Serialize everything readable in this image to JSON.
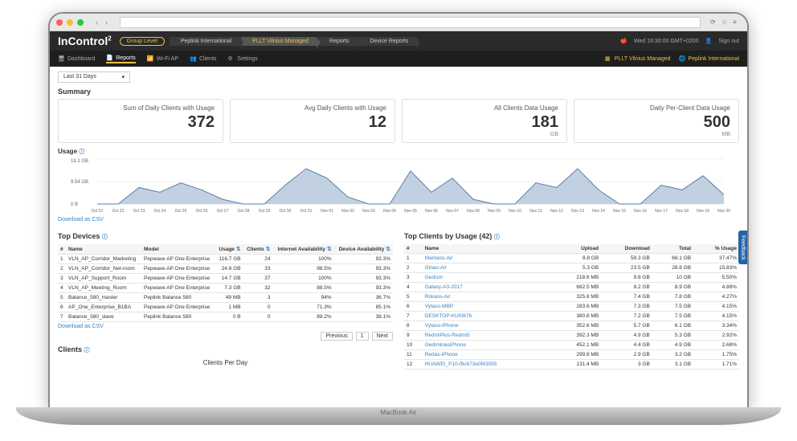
{
  "browser": {
    "macbook_label": "MacBook Air"
  },
  "topbar": {
    "logo": "InControl",
    "logo_sup": "2",
    "group_level": "Group Level",
    "crumbs": [
      "Peplink International",
      "PLLT Vilnius Managed",
      "Reports",
      "Device Reports"
    ],
    "active_crumb": 1,
    "time": "Wed 16:30:00 GMT+0200",
    "user_icon": "user",
    "signout": "Sign out"
  },
  "nav": {
    "items": [
      {
        "icon": "monitor",
        "label": "Dashboard"
      },
      {
        "icon": "doc",
        "label": "Reports"
      },
      {
        "icon": "wifi",
        "label": "Wi-Fi AP"
      },
      {
        "icon": "users",
        "label": "Clients"
      },
      {
        "icon": "gear",
        "label": "Settings"
      }
    ],
    "active": 1,
    "right": [
      {
        "icon": "grid",
        "label": "PLLT Vilnius Managed"
      },
      {
        "icon": "globe",
        "label": "Peplink International"
      }
    ]
  },
  "period": {
    "label": "Last 31 Days"
  },
  "summary": {
    "title": "Summary",
    "cards": [
      {
        "label": "Sum of Daily Clients with Usage",
        "value": "372",
        "unit": ""
      },
      {
        "label": "Avg Daily Clients with Usage",
        "value": "12",
        "unit": ""
      },
      {
        "label": "All Clients Data Usage",
        "value": "181",
        "unit": "GB"
      },
      {
        "label": "Daily Per-Client Data Usage",
        "value": "500",
        "unit": "MB"
      }
    ]
  },
  "usage": {
    "title": "Usage",
    "ymax_label": "19.1 GB",
    "ymid_label": "9.54 GB",
    "ymin_label": "0 B",
    "csv": "Download as CSV"
  },
  "chart_data": {
    "type": "area",
    "title": "Usage",
    "ylabel": "Data",
    "ylim": [
      0,
      19.1
    ],
    "y_unit": "GB",
    "categories": [
      "Oct 21",
      "Oct 22",
      "Oct 23",
      "Oct 24",
      "Oct 25",
      "Oct 26",
      "Oct 27",
      "Oct 28",
      "Oct 29",
      "Oct 30",
      "Oct 31",
      "Nov 01",
      "Nov 02",
      "Nov 03",
      "Nov 04",
      "Nov 05",
      "Nov 06",
      "Nov 07",
      "Nov 08",
      "Nov 09",
      "Nov 10",
      "Nov 11",
      "Nov 12",
      "Nov 13",
      "Nov 14",
      "Nov 15",
      "Nov 16",
      "Nov 17",
      "Nov 18",
      "Nov 19",
      "Nov 20"
    ],
    "values": [
      0,
      0,
      7,
      5,
      9,
      6,
      2,
      0,
      0,
      8,
      15,
      11,
      3,
      0,
      0,
      14,
      5,
      11,
      2,
      0,
      0,
      9,
      7,
      15,
      6,
      0,
      0,
      8,
      6,
      12,
      4
    ]
  },
  "top_devices": {
    "title": "Top Devices",
    "headers": [
      "#",
      "Name",
      "Model",
      "Usage",
      "Clients",
      "Internet Availability",
      "Device Availability"
    ],
    "rows": [
      [
        "1",
        "VLN_AP_Corridor_Marketing",
        "Pepwave AP One Enterprise",
        "116.7 GB",
        "24",
        "100%",
        "93.3%"
      ],
      [
        "2",
        "VLN_AP_Corridor_Net-room",
        "Pepwave AP One Enterprise",
        "24.8 GB",
        "33",
        "98.5%",
        "93.3%"
      ],
      [
        "3",
        "VLN_AP_Support_Room",
        "Pepwave AP One Enterprise",
        "14.7 GB",
        "37",
        "100%",
        "93.3%"
      ],
      [
        "4",
        "VLN_AP_Meeting_Room",
        "Pepwave AP One Enterprise",
        "7.3 GB",
        "32",
        "88.5%",
        "93.3%"
      ],
      [
        "5",
        "Balance_580_master",
        "Peplink Balance 580",
        "49 MB",
        "3",
        "94%",
        "36.7%"
      ],
      [
        "6",
        "AP_One_Enterprise_B1BA",
        "Pepwave AP One Enterprise",
        "1 MB",
        "0",
        "71.3%",
        "85.1%"
      ],
      [
        "7",
        "Balance_580_slave",
        "Peplink Balance 580",
        "0 B",
        "0",
        "89.2%",
        "38.1%"
      ]
    ],
    "csv": "Download as CSV",
    "pager": {
      "prev": "Previous",
      "page": "1",
      "next": "Next"
    }
  },
  "top_clients": {
    "title": "Top Clients by Usage (42)",
    "headers": [
      "#",
      "Name",
      "Upload",
      "Download",
      "Total",
      "% Usage"
    ],
    "rows": [
      [
        "1",
        "Mantass-Air",
        "8.8 GB",
        "59.3 GB",
        "68.1 GB",
        "37.47%"
      ],
      [
        "2",
        "Ginas-Air",
        "5.3 GB",
        "23.5 GB",
        "28.8 GB",
        "15.83%"
      ],
      [
        "3",
        "Gedism",
        "218.6 MB",
        "9.8 GB",
        "10 GB",
        "5.50%"
      ],
      [
        "4",
        "Galaxy-A3-2017",
        "682.5 MB",
        "8.2 GB",
        "8.9 GB",
        "4.88%"
      ],
      [
        "5",
        "Rokass-Air",
        "325.8 MB",
        "7.4 GB",
        "7.8 GB",
        "4.27%"
      ],
      [
        "6",
        "Vytass-MBP",
        "283.6 MB",
        "7.3 GB",
        "7.5 GB",
        "4.15%"
      ],
      [
        "7",
        "DESKTOP-KU0I676",
        "380.8 MB",
        "7.2 GB",
        "7.5 GB",
        "4.15%"
      ],
      [
        "8",
        "Vytass-iPhone",
        "352.6 MB",
        "5.7 GB",
        "6.1 GB",
        "3.34%"
      ],
      [
        "9",
        "RedmiPlus-Redmi5",
        "392.3 MB",
        "4.9 GB",
        "5.3 GB",
        "2.92%"
      ],
      [
        "10",
        "GediminasiPhone",
        "452.1 MB",
        "4.4 GB",
        "4.9 GB",
        "2.68%"
      ],
      [
        "11",
        "Redas-iPhone",
        "299.8 MB",
        "2.9 GB",
        "3.2 GB",
        "1.75%"
      ],
      [
        "12",
        "HUAWEI_P10-f8c673e0f43055",
        "131.4 MB",
        "3 GB",
        "3.1 GB",
        "1.71%"
      ]
    ]
  },
  "clients": {
    "title": "Clients",
    "chart_title": "Clients Per Day"
  },
  "feedback": "Feedback"
}
